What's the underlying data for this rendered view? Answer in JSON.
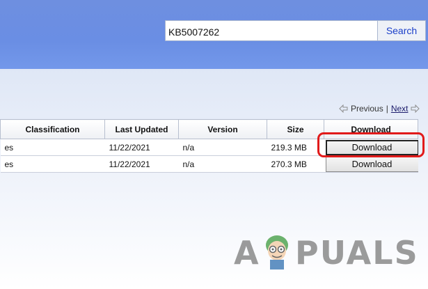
{
  "search": {
    "query": "KB5007262",
    "button_label": "Search"
  },
  "pager": {
    "previous_label": "Previous",
    "next_label": "Next"
  },
  "table": {
    "headers": [
      "Classification",
      "Last Updated",
      "Version",
      "Size",
      "Download"
    ],
    "rows": [
      {
        "classification_fragment": "es",
        "last_updated": "11/22/2021",
        "version": "n/a",
        "size": "219.3 MB",
        "download_label": "Download"
      },
      {
        "classification_fragment": "es",
        "last_updated": "11/22/2021",
        "version": "n/a",
        "size": "270.3 MB",
        "download_label": "Download"
      }
    ]
  },
  "watermark": {
    "text_left": "A",
    "text_right": "PUALS"
  },
  "colors": {
    "header_band": "#6a8ee4",
    "highlight": "#e11a1a",
    "link": "#1a3ec9"
  }
}
